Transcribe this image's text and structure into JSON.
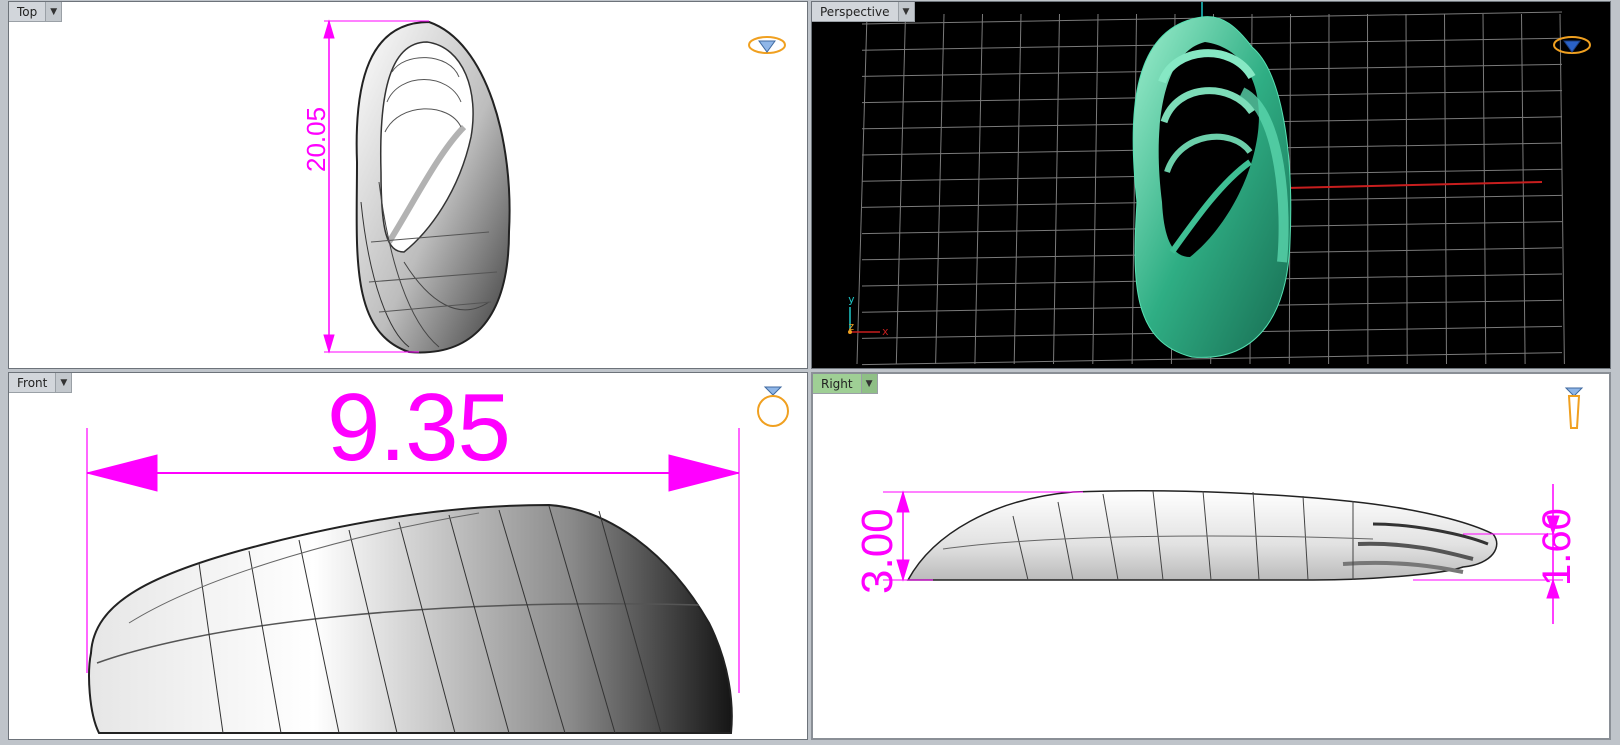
{
  "viewports": {
    "top": {
      "label": "Top",
      "dimension": "20.05"
    },
    "perspective": {
      "label": "Perspective",
      "axis_y": "y",
      "axis_z": "z",
      "axis_x": "x"
    },
    "front": {
      "label": "Front",
      "dimension": "9.35"
    },
    "right": {
      "label": "Right",
      "dimension_a": "3.00",
      "dimension_b": "1.60"
    }
  },
  "icons": {
    "dropdown": "chevron-down-icon",
    "top_view": "ring-top-view-icon",
    "perspective_view": "ring-perspective-view-icon",
    "front_view": "ring-front-view-icon",
    "right_view": "ring-side-view-icon"
  },
  "colors": {
    "dimension": "#ff00ff",
    "perspective_bg": "#000000",
    "grid": "#7a7a7a",
    "model_green": "#2fae84",
    "axis_x": "#c81e1e",
    "axis_y": "#1ec8c8",
    "active_tab": "#9fcf95",
    "icon_gold": "#f0a020"
  }
}
